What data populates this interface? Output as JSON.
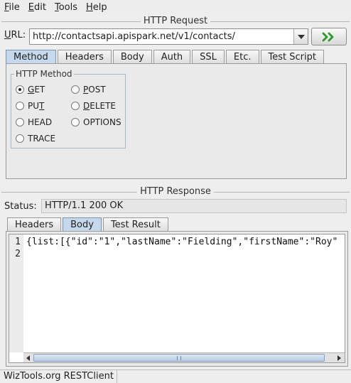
{
  "menu": [
    {
      "label": "File",
      "mnemonic": "F",
      "rest": "ile"
    },
    {
      "label": "Edit",
      "mnemonic": "E",
      "rest": "dit"
    },
    {
      "label": "Tools",
      "mnemonic": "T",
      "rest": "ools"
    },
    {
      "label": "Help",
      "mnemonic": "H",
      "rest": "elp"
    }
  ],
  "request": {
    "section_title": "HTTP Request",
    "url_label_mnemonic": "U",
    "url_label_rest": "RL:",
    "url_value": "http://contactsapi.apispark.net/v1/contacts/",
    "tabs": [
      "Method",
      "Headers",
      "Body",
      "Auth",
      "SSL",
      "Etc.",
      "Test Script"
    ],
    "active_tab": "Method",
    "method_group_title": "HTTP Method",
    "methods": {
      "get": {
        "pre": "",
        "mn": "G",
        "post": "ET",
        "checked": true
      },
      "post": {
        "pre": "",
        "mn": "P",
        "post": "OST",
        "checked": false
      },
      "put": {
        "pre": "PU",
        "mn": "T",
        "post": "",
        "checked": false
      },
      "delete": {
        "pre": "",
        "mn": "D",
        "post": "ELETE",
        "checked": false
      },
      "head": {
        "pre": "HEAD",
        "mn": "",
        "post": "",
        "checked": false
      },
      "options": {
        "pre": "OPTIONS",
        "mn": "",
        "post": "",
        "checked": false
      },
      "trace": {
        "pre": "TRACE",
        "mn": "",
        "post": "",
        "checked": false
      }
    }
  },
  "response": {
    "section_title": "HTTP Response",
    "status_label": "Status:",
    "status_value": "HTTP/1.1 200 OK",
    "tabs": [
      "Headers",
      "Body",
      "Test Result"
    ],
    "active_tab": "Body",
    "line_numbers": [
      "1",
      "2"
    ],
    "body_line1": "{list:[{\"id\":\"1\",\"lastName\":\"Fielding\",\"firstName\":\"Roy\""
  },
  "statusbar": {
    "text": "WizTools.org RESTClient"
  },
  "icons": {
    "go": "double-chevron-right-icon",
    "dropdown": "chevron-down-icon"
  },
  "colors": {
    "go_arrow": "#2e9a2e",
    "active_tab": "#c6d8ec"
  }
}
